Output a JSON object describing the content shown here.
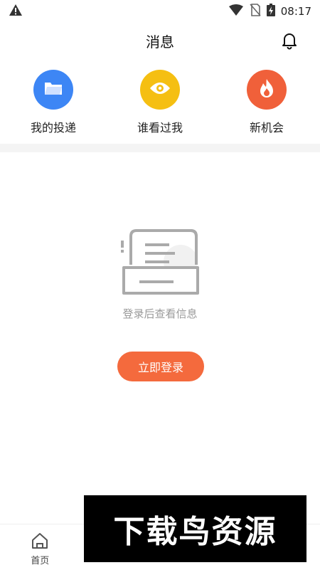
{
  "status_bar": {
    "time": "08:17"
  },
  "header": {
    "title": "消息"
  },
  "shortcuts": [
    {
      "label": "我的投递",
      "color": "#3d86f5",
      "icon": "folder-icon"
    },
    {
      "label": "谁看过我",
      "color": "#f5bf12",
      "icon": "eye-icon"
    },
    {
      "label": "新机会",
      "color": "#f0603a",
      "icon": "flame-icon"
    }
  ],
  "empty_state": {
    "message": "登录后查看信息",
    "login_label": "立即登录"
  },
  "tabbar": {
    "active_color": "#f46a3d",
    "items": [
      {
        "label": "首页",
        "icon": "home-icon"
      },
      {
        "label": "",
        "icon": ""
      },
      {
        "label": "",
        "icon": ""
      },
      {
        "label": "",
        "icon": ""
      }
    ]
  },
  "watermark": {
    "text": "下载鸟资源"
  }
}
